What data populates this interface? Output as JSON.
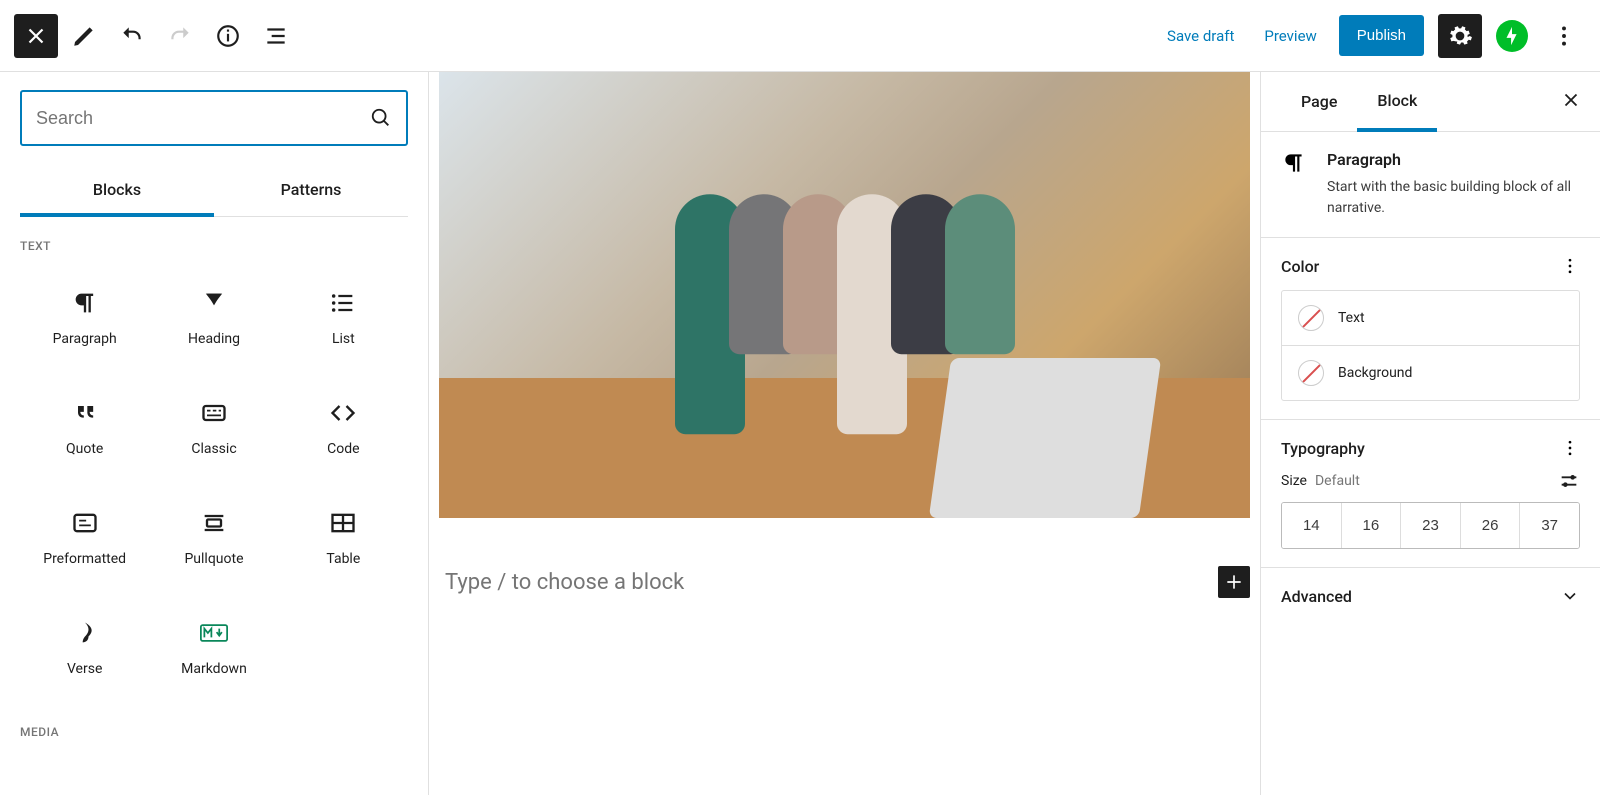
{
  "topbar": {
    "save_draft": "Save draft",
    "preview": "Preview",
    "publish": "Publish"
  },
  "inserter": {
    "search_placeholder": "Search",
    "tabs": {
      "blocks": "Blocks",
      "patterns": "Patterns"
    },
    "sections": {
      "text": "TEXT",
      "media": "MEDIA"
    },
    "blocks": {
      "paragraph": "Paragraph",
      "heading": "Heading",
      "list": "List",
      "quote": "Quote",
      "classic": "Classic",
      "code": "Code",
      "preformatted": "Preformatted",
      "pullquote": "Pullquote",
      "table": "Table",
      "verse": "Verse",
      "markdown": "Markdown"
    }
  },
  "canvas": {
    "placeholder": "Type / to choose a block"
  },
  "sidebar": {
    "tabs": {
      "page": "Page",
      "block": "Block"
    },
    "block": {
      "name": "Paragraph",
      "description": "Start with the basic building block of all narrative."
    },
    "color": {
      "title": "Color",
      "text": "Text",
      "background": "Background"
    },
    "typography": {
      "title": "Typography",
      "size_label": "Size",
      "size_value": "Default",
      "options": [
        "14",
        "16",
        "23",
        "26",
        "37"
      ]
    },
    "advanced": {
      "title": "Advanced"
    }
  }
}
